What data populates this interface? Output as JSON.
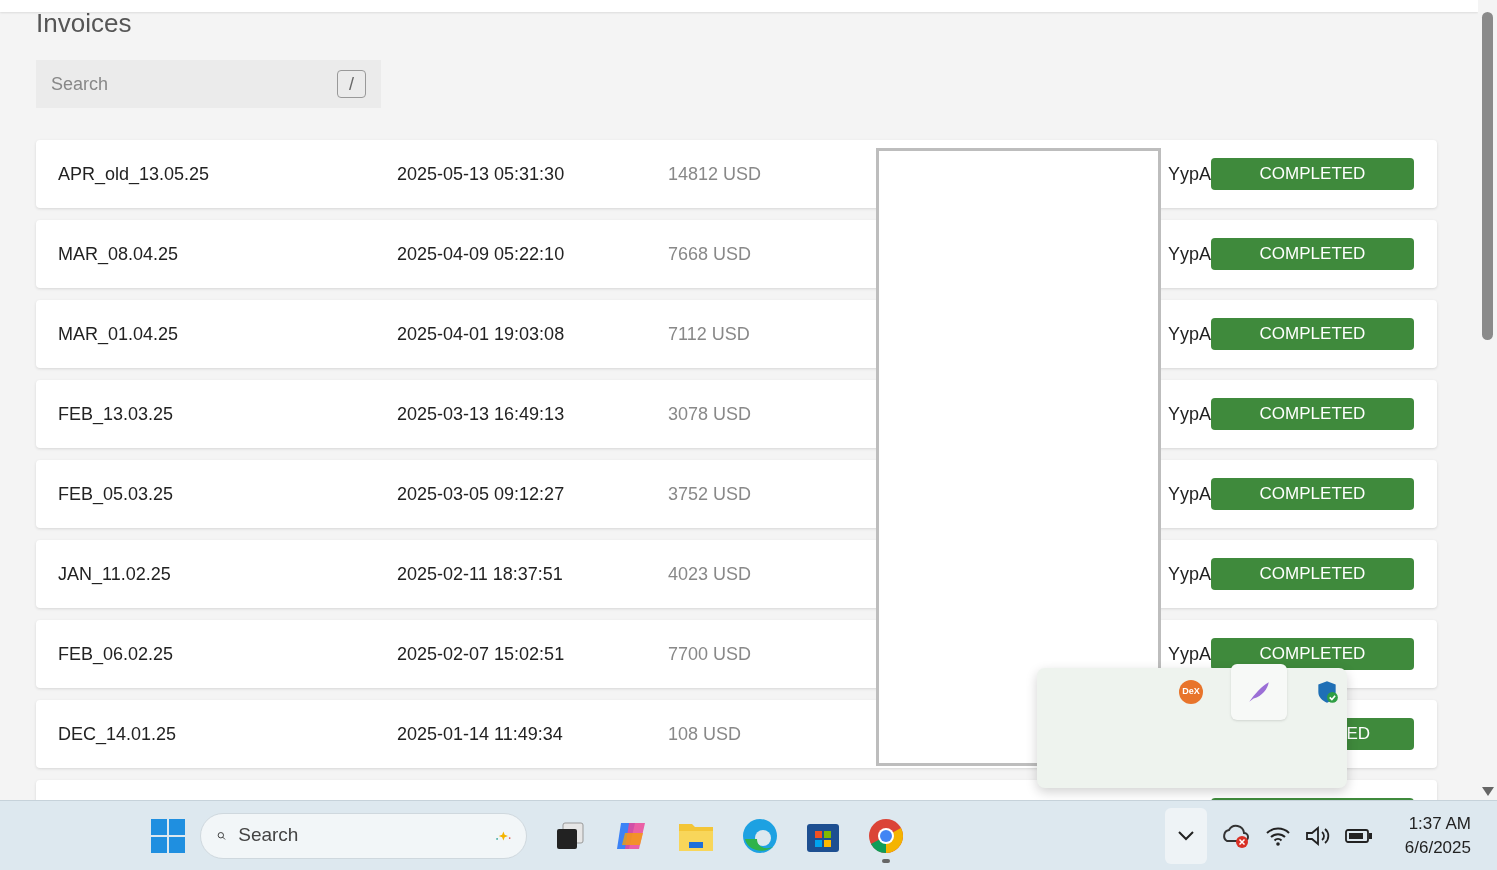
{
  "page": {
    "title": "Invoices",
    "search": {
      "placeholder": "Search",
      "shortcut": "/"
    }
  },
  "invoices": [
    {
      "name": "APR_old_13.05.25",
      "date": "2025-05-13 05:31:30",
      "amount": "14812 USD",
      "reference": "YypA",
      "status": "COMPLETED",
      "covered": false
    },
    {
      "name": "MAR_08.04.25",
      "date": "2025-04-09 05:22:10",
      "amount": "7668 USD",
      "reference": "YypA",
      "status": "COMPLETED",
      "covered": false
    },
    {
      "name": "MAR_01.04.25",
      "date": "2025-04-01 19:03:08",
      "amount": "7112 USD",
      "reference": "YypA",
      "status": "COMPLETED",
      "covered": false
    },
    {
      "name": "FEB_13.03.25",
      "date": "2025-03-13 16:49:13",
      "amount": "3078 USD",
      "reference": "YypA",
      "status": "COMPLETED",
      "covered": false
    },
    {
      "name": "FEB_05.03.25",
      "date": "2025-03-05 09:12:27",
      "amount": "3752 USD",
      "reference": "YypA",
      "status": "COMPLETED",
      "covered": false
    },
    {
      "name": "JAN_11.02.25",
      "date": "2025-02-11 18:37:51",
      "amount": "4023 USD",
      "reference": "YypA",
      "status": "COMPLETED",
      "covered": false
    },
    {
      "name": "FEB_06.02.25",
      "date": "2025-02-07 15:02:51",
      "amount": "7700 USD",
      "reference": "YypA",
      "status": "COMPLETED",
      "covered": false
    },
    {
      "name": "DEC_14.01.25",
      "date": "2025-01-14 11:49:34",
      "amount": "108 USD",
      "status": "ED",
      "covered": true
    }
  ],
  "tray_popup": {
    "dex_label": "DeX"
  },
  "taskbar": {
    "search": {
      "placeholder": "Search"
    },
    "time": "1:37 AM",
    "date": "6/6/2025"
  }
}
